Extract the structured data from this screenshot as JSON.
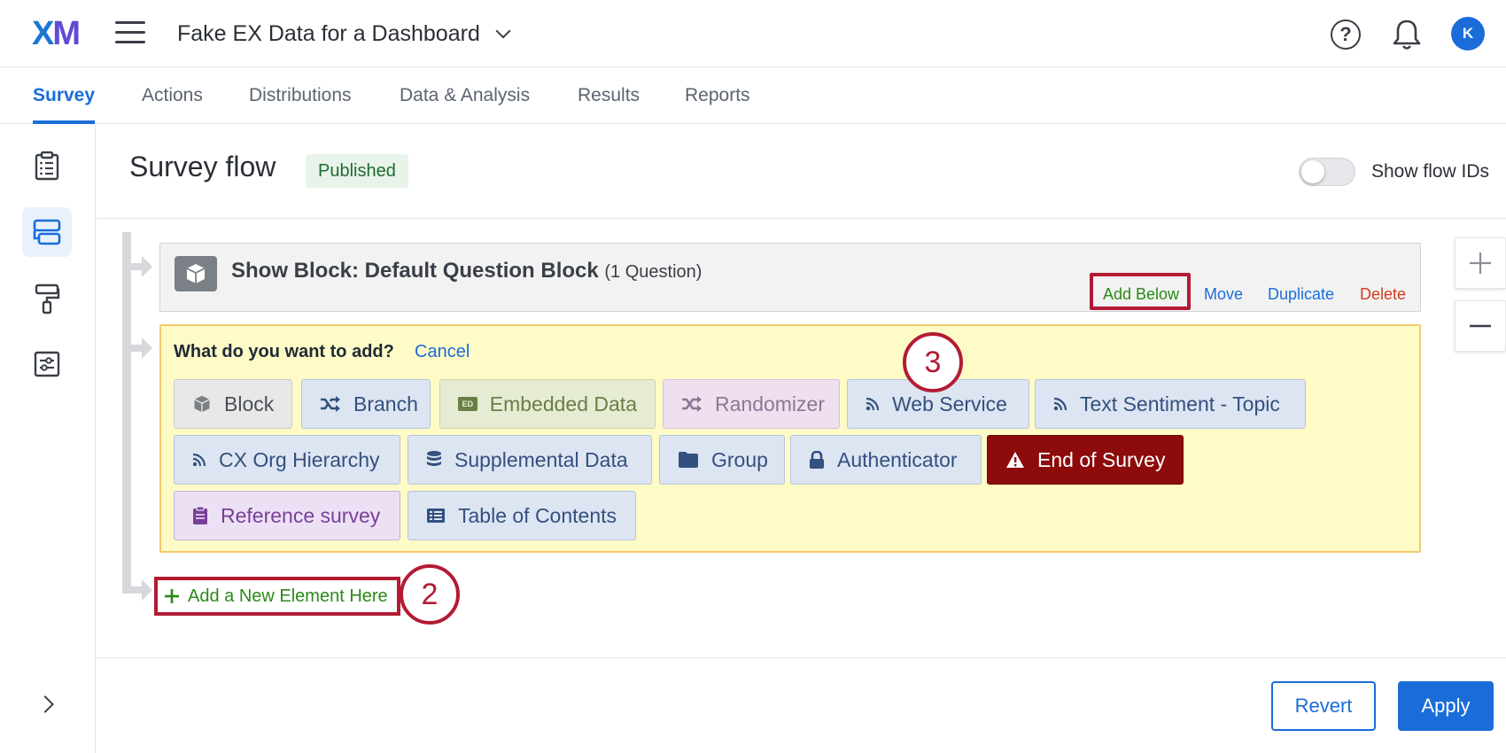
{
  "app": {
    "logo_x": "X",
    "logo_m": "M",
    "project_title": "Fake EX Data for a Dashboard",
    "help_glyph": "?",
    "avatar_initial": "K"
  },
  "tabs": [
    {
      "label": "Survey",
      "active": true
    },
    {
      "label": "Actions"
    },
    {
      "label": "Distributions"
    },
    {
      "label": "Data & Analysis"
    },
    {
      "label": "Results"
    },
    {
      "label": "Reports"
    }
  ],
  "rail": {
    "items": [
      {
        "icon": "clipboard-icon"
      },
      {
        "icon": "survey-flow-icon",
        "active": true
      },
      {
        "icon": "paint-roller-icon"
      },
      {
        "icon": "survey-options-icon"
      }
    ]
  },
  "header": {
    "title": "Survey flow",
    "status": "Published",
    "toggle_label": "Show flow IDs",
    "toggle_on": false
  },
  "block": {
    "title_bold": "Show Block: Default Question Block",
    "title_sub": "(1 Question)",
    "actions": {
      "add_below": "Add Below",
      "move": "Move",
      "duplicate": "Duplicate",
      "delete": "Delete"
    }
  },
  "add_panel": {
    "question": "What do you want to add?",
    "cancel": "Cancel",
    "elements": [
      "Block",
      "Branch",
      "Embedded Data",
      "Randomizer",
      "Web Service",
      "Text Sentiment - Topic",
      "CX Org Hierarchy",
      "Supplemental Data",
      "Group",
      "Authenticator",
      "End of Survey",
      "Reference survey",
      "Table of Contents"
    ],
    "embedded_icon_text": "ED"
  },
  "add_new": {
    "label": "Add a New Element Here"
  },
  "callouts": [
    "2",
    "3"
  ],
  "footer": {
    "revert": "Revert",
    "apply": "Apply"
  },
  "colors": {
    "accent": "#1a6dd9",
    "highlight": "#b31b34",
    "end_of_survey": "#8d0b0b",
    "panel_bg": "#fefbc6"
  }
}
